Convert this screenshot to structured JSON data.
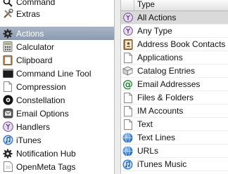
{
  "left_panel": {
    "items": [
      {
        "label": "Command",
        "icon": "search-icon"
      },
      {
        "label": "Extras",
        "icon": "tools-icon"
      },
      {
        "label": "Actions",
        "icon": "gear-icon",
        "selected": true
      },
      {
        "label": "Calculator",
        "icon": "calculator-icon"
      },
      {
        "label": "Clipboard",
        "icon": "clipboard-icon"
      },
      {
        "label": "Command Line Tool",
        "icon": "terminal-icon"
      },
      {
        "label": "Compression",
        "icon": "document-icon"
      },
      {
        "label": "Constellation",
        "icon": "constellation-icon"
      },
      {
        "label": "Email Options",
        "icon": "email-options-icon"
      },
      {
        "label": "Handlers",
        "icon": "handlers-icon"
      },
      {
        "label": "iTunes",
        "icon": "itunes-icon"
      },
      {
        "label": "Notification Hub",
        "icon": "gear-icon"
      },
      {
        "label": "OpenMeta Tags",
        "icon": "tag-icon"
      }
    ]
  },
  "right_panel": {
    "column_header": "Type",
    "items": [
      {
        "label": "All Actions",
        "icon": "action-icon",
        "selected": true
      },
      {
        "label": "Any Type",
        "icon": "action-icon"
      },
      {
        "label": "Address Book Contacts",
        "icon": "address-book-icon"
      },
      {
        "label": "Applications",
        "icon": "document-icon"
      },
      {
        "label": "Catalog Entries",
        "icon": "catalog-icon"
      },
      {
        "label": "Email Addresses",
        "icon": "at-sign-icon"
      },
      {
        "label": "Files & Folders",
        "icon": "document-icon"
      },
      {
        "label": "IM Accounts",
        "icon": "document-icon"
      },
      {
        "label": "Text",
        "icon": "document-icon"
      },
      {
        "label": "Text Lines",
        "icon": "globe-icon"
      },
      {
        "label": "URLs",
        "icon": "globe-icon"
      },
      {
        "label": "iTunes Music",
        "icon": "itunes-icon"
      }
    ]
  },
  "colors": {
    "left_selection": "#98a5b9",
    "right_selection": "#d9d9d9",
    "splitter": "#ececec"
  }
}
